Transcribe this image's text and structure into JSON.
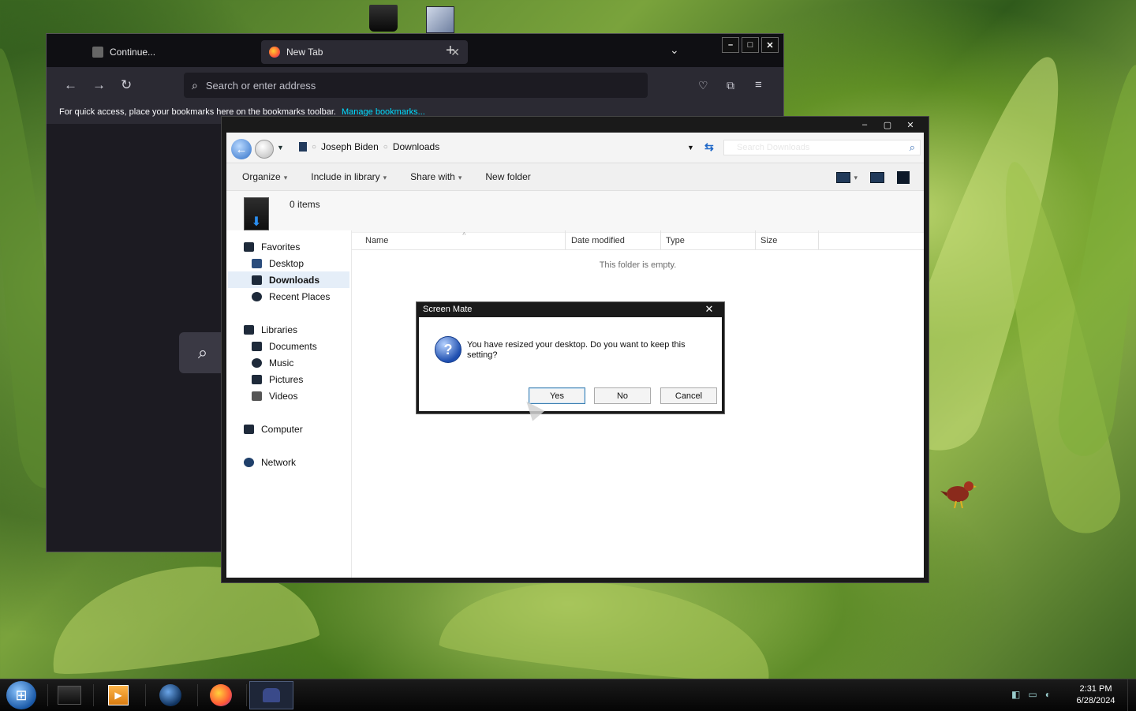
{
  "browser": {
    "tabs": [
      {
        "label": "Continue...",
        "icon": "briefcase-icon"
      },
      {
        "label": "New Tab",
        "icon": "firefox-icon",
        "active": true
      }
    ],
    "url_placeholder": "Search or enter address",
    "bookmarks_text": "For quick access, place your bookmarks here on the bookmarks toolbar.",
    "bookmarks_link": "Manage bookmarks..."
  },
  "explorer": {
    "breadcrumb": [
      "Joseph Biden",
      "Downloads"
    ],
    "search_placeholder": "Search Downloads",
    "commands": [
      "Organize",
      "Include in library",
      "Share with",
      "New folder"
    ],
    "item_count": "0 items",
    "nav": {
      "favorites": "Favorites",
      "desktop": "Desktop",
      "downloads": "Downloads",
      "recent": "Recent Places",
      "libraries": "Libraries",
      "documents": "Documents",
      "music": "Music",
      "pictures": "Pictures",
      "videos": "Videos",
      "computer": "Computer",
      "network": "Network"
    },
    "columns": [
      "Name",
      "Date modified",
      "Type",
      "Size"
    ],
    "empty_text": "This folder is empty."
  },
  "dialog": {
    "title": "Screen Mate",
    "message": "You have resized your desktop. Do you want to keep this setting?",
    "buttons": {
      "yes": "Yes",
      "no": "No",
      "cancel": "Cancel"
    }
  },
  "taskbar": {
    "time": "2:31 PM",
    "date": "6/28/2024"
  },
  "colors": {
    "accent": "#1f68c8",
    "link": "#00ddff"
  }
}
